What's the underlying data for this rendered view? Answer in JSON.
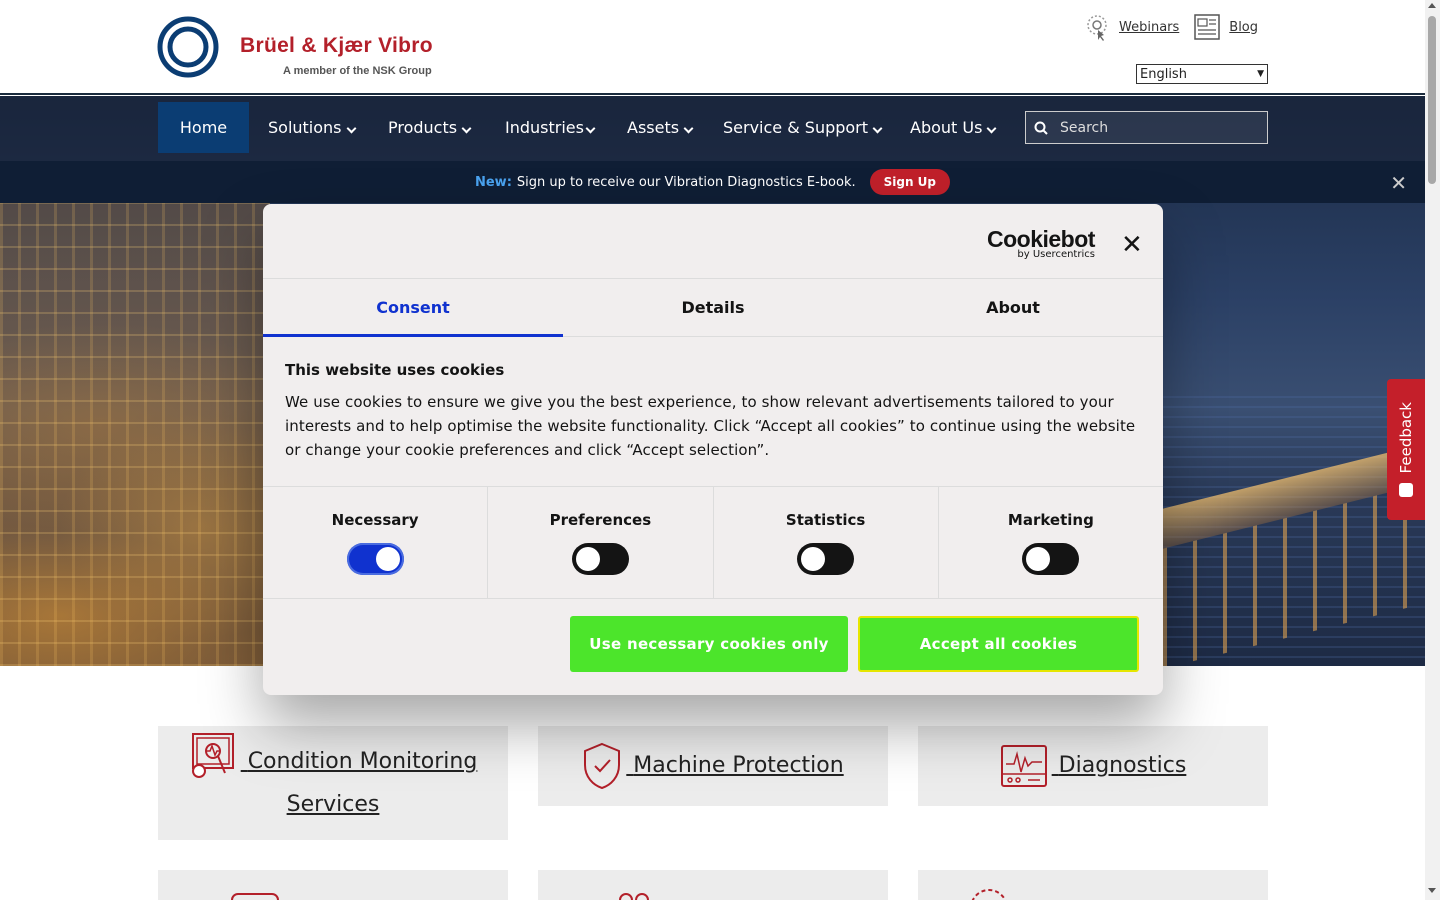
{
  "header": {
    "logo_title": "Brüel & Kjær Vibro",
    "logo_subtitle": "A member of the NSK Group",
    "links": {
      "webinars": "Webinars",
      "blog": "Blog"
    },
    "language": "English"
  },
  "nav": {
    "items": [
      "Home",
      "Solutions",
      "Products",
      "Industries",
      "Assets",
      "Service & Support",
      "About Us"
    ],
    "search_placeholder": "Search"
  },
  "banner": {
    "new_label": "New:",
    "text": "Sign up to receive our Vibration Diagnostics E-book.",
    "button": "Sign Up",
    "close": "✕"
  },
  "cookie_dialog": {
    "brand": "Cookiebot",
    "brand_sub": "by Usercentrics",
    "close": "✕",
    "tabs": [
      "Consent",
      "Details",
      "About"
    ],
    "active_tab": "Consent",
    "heading": "This website uses cookies",
    "body": "We use cookies to ensure we give you the best experience, to show relevant advertisements tailored to your interests and to help optimise the website functionality. Click “Accept all cookies” to continue using the website or change your cookie preferences and click “Accept selection”.",
    "toggles": [
      {
        "label": "Necessary",
        "on": true
      },
      {
        "label": "Preferences",
        "on": false
      },
      {
        "label": "Statistics",
        "on": false
      },
      {
        "label": "Marketing",
        "on": false
      }
    ],
    "buttons": {
      "necessary": "Use necessary cookies only",
      "accept": "Accept all cookies"
    }
  },
  "feedback": "Feedback",
  "cards": [
    {
      "label": "Condition Monitoring Services",
      "icon": "monitoring-icon"
    },
    {
      "label": "Machine Protection",
      "icon": "shield-check-icon"
    },
    {
      "label": "Diagnostics",
      "icon": "diagnostics-icon"
    }
  ],
  "colors": {
    "brand_red": "#b3202a",
    "nav_blue": "#0b3d73",
    "cookiebot_blue": "#1032cf",
    "accept_green": "#4ce52b"
  }
}
